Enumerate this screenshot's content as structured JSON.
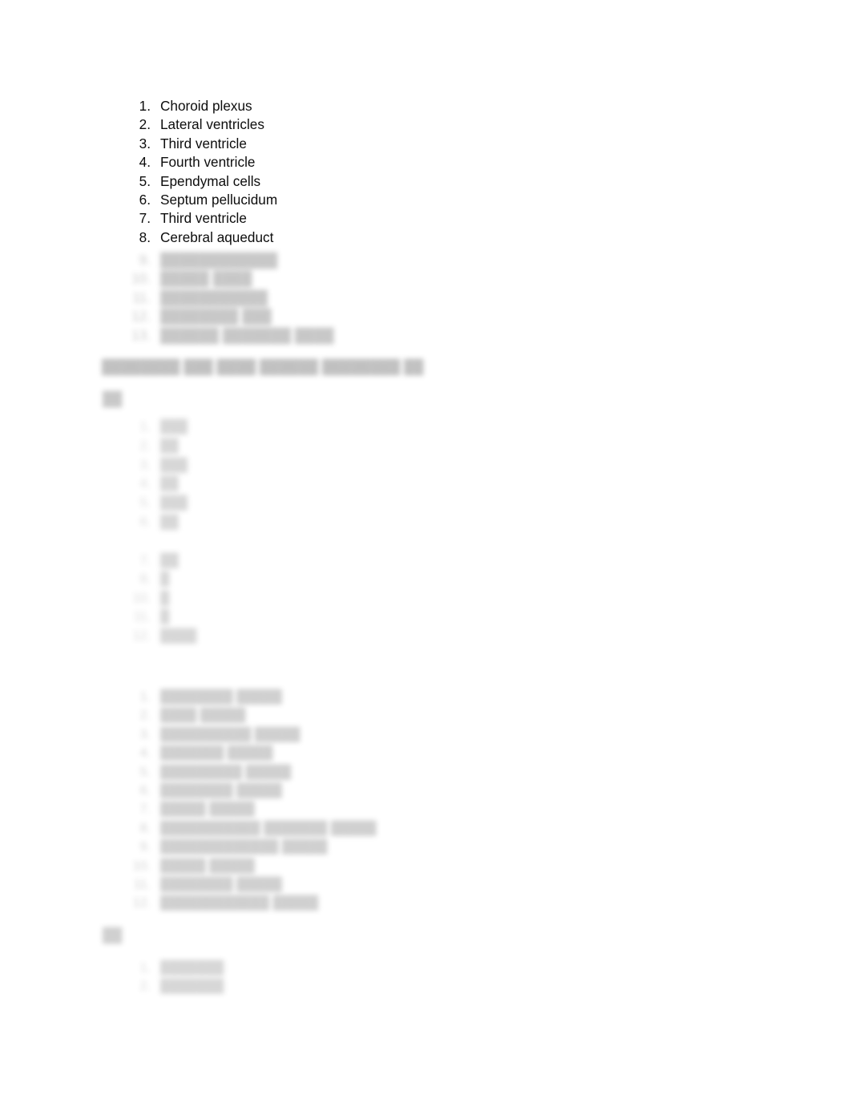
{
  "document": {
    "background_color": "#ffffff",
    "text_color": "#0d0d0d",
    "blurred_text_color": "#4a4a4a"
  },
  "legible_list": {
    "items": [
      {
        "number": "1.",
        "label": "Choroid plexus"
      },
      {
        "number": "2.",
        "label": "Lateral ventricles"
      },
      {
        "number": "3.",
        "label": "Third ventricle"
      },
      {
        "number": "4.",
        "label": "Fourth ventricle"
      },
      {
        "number": "5.",
        "label": "Ependymal cells"
      },
      {
        "number": "6.",
        "label": "Septum pellucidum"
      },
      {
        "number": "7.",
        "label": "Third ventricle"
      },
      {
        "number": "8.",
        "label": "Cerebral aqueduct"
      }
    ]
  },
  "blurred_list_continued": {
    "items": [
      {
        "number": "9.",
        "label": "████████████"
      },
      {
        "number": "10.",
        "label": "█████ ████"
      },
      {
        "number": "11.",
        "label": "███████████"
      },
      {
        "number": "12.",
        "label": "████████ ███"
      },
      {
        "number": "13.",
        "label": "██████ ███████ ████"
      }
    ]
  },
  "blurred_heading": {
    "text": "████████ ███ ████ ██████ ████████ ██"
  },
  "blurred_marker_a": {
    "text": "██"
  },
  "blurred_short_list": {
    "items": [
      {
        "number": "1.",
        "label": "███"
      },
      {
        "number": "2.",
        "label": "██"
      },
      {
        "number": "3.",
        "label": "███"
      },
      {
        "number": "4.",
        "label": "██"
      },
      {
        "number": "5.",
        "label": "███"
      },
      {
        "number": "6.",
        "label": "██"
      }
    ]
  },
  "blurred_short_list_2": {
    "items": [
      {
        "number": "7.",
        "label": "██"
      },
      {
        "number": "8.",
        "label": "█"
      },
      {
        "number": "10.",
        "label": "█"
      },
      {
        "number": "11.",
        "label": "█"
      },
      {
        "number": "12.",
        "label": "████"
      }
    ]
  },
  "blurred_nerve_list": {
    "items": [
      {
        "number": "1.",
        "label": "████████ █████"
      },
      {
        "number": "2.",
        "label": "████ █████"
      },
      {
        "number": "3.",
        "label": "██████████ █████"
      },
      {
        "number": "4.",
        "label": "███████ █████"
      },
      {
        "number": "5.",
        "label": "█████████ █████"
      },
      {
        "number": "6.",
        "label": "████████ █████"
      },
      {
        "number": "7.",
        "label": "█████ █████"
      },
      {
        "number": "8.",
        "label": "███████████ ███████ █████"
      },
      {
        "number": "9.",
        "label": "█████████████ █████"
      },
      {
        "number": "10.",
        "label": "█████ █████"
      },
      {
        "number": "11.",
        "label": "████████ █████"
      },
      {
        "number": "12.",
        "label": "████████████ █████"
      }
    ]
  },
  "blurred_marker_b": {
    "text": "██"
  },
  "blurred_bottom_list": {
    "items": [
      {
        "number": "1.",
        "label": "███████"
      },
      {
        "number": "2.",
        "label": "███████"
      }
    ]
  }
}
